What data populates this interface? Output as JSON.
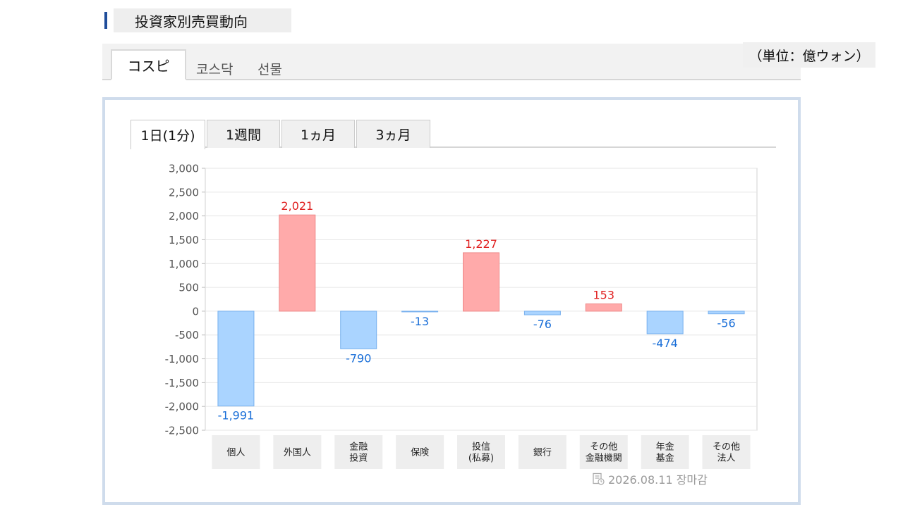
{
  "section": {
    "title": "投資家別売買動向"
  },
  "market_tabs": [
    {
      "label": "コスピ",
      "active": true
    },
    {
      "label": "코스닥",
      "active": false
    },
    {
      "label": "선물",
      "active": false
    }
  ],
  "unit_label": "（単位：億ウォン）",
  "period_tabs": [
    {
      "label": "1日(1分)",
      "active": true
    },
    {
      "label": "1週間",
      "active": false
    },
    {
      "label": "1ヵ月",
      "active": false
    },
    {
      "label": "3ヵ月",
      "active": false
    }
  ],
  "footer": {
    "text": "2026.08.11 장마감",
    "icon": "document-icon"
  },
  "colors": {
    "positive_fill": "#ffaaaa",
    "positive_stroke": "#ee8888",
    "positive_label": "#e02020",
    "negative_fill": "#aad4ff",
    "negative_stroke": "#77b0ee",
    "negative_label": "#1a6fd8",
    "panel_border": "#cfdcec"
  },
  "chart_data": {
    "type": "bar",
    "title": "",
    "xlabel": "",
    "ylabel": "",
    "ylim": [
      -2500,
      3000
    ],
    "yticks": [
      3000,
      2500,
      2000,
      1500,
      1000,
      500,
      0,
      -500,
      -1000,
      -1500,
      -2000,
      -2500
    ],
    "ytick_labels": [
      "3,000",
      "2,500",
      "2,000",
      "1,500",
      "1,000",
      "500",
      "0",
      "-500",
      "-1,000",
      "-1,500",
      "-2,000",
      "-2,500"
    ],
    "grid": true,
    "categories": [
      "個人",
      "外国人",
      "金融\n投資",
      "保険",
      "投信\n(私募)",
      "銀行",
      "その他\n金融機関",
      "年金\n基金",
      "その他\n法人"
    ],
    "values": [
      -1991,
      2021,
      -790,
      -13,
      1227,
      -76,
      153,
      -474,
      -56
    ],
    "value_labels": [
      "-1,991",
      "2,021",
      "-790",
      "-13",
      "1,227",
      "-76",
      "153",
      "-474",
      "-56"
    ]
  }
}
